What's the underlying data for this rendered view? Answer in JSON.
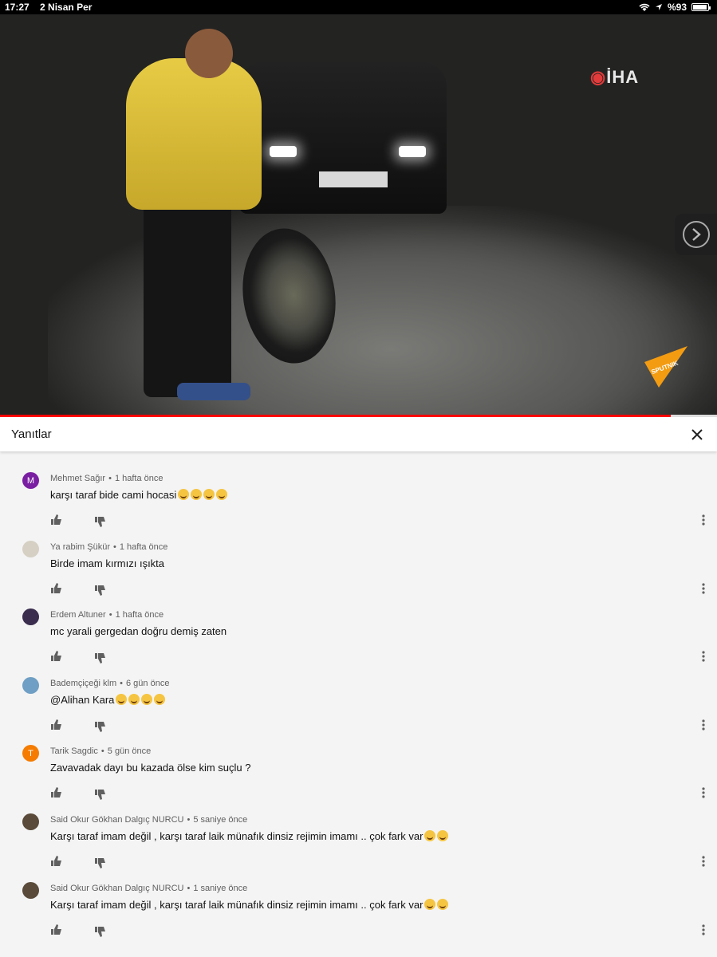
{
  "status_bar": {
    "time": "17:27",
    "date": "2 Nisan Per",
    "battery": "%93",
    "icons": [
      "wifi-icon",
      "location-icon",
      "battery-icon"
    ]
  },
  "video": {
    "watermark": "İHA",
    "brand_badge": "SPUTNIK",
    "progress_fraction": 0.935,
    "next_button": "chevron-right-icon"
  },
  "panel": {
    "title": "Yanıtlar",
    "close_icon": "close-icon"
  },
  "comments": [
    {
      "author": "Mehmet Sağır",
      "time": "1 hafta önce",
      "text": "karşı taraf bide cami hocasi",
      "emoji_count": 4,
      "avatar_letter": "M",
      "avatar_color": "#7b1fa2"
    },
    {
      "author": "Ya rabim Şükür",
      "time": "1 hafta önce",
      "text": "Birde imam kırmızı ışıkta",
      "emoji_count": 0,
      "avatar_letter": "",
      "avatar_color": "#d6d0c4"
    },
    {
      "author": "Erdem Altuner",
      "time": "1 hafta önce",
      "text": "mc yarali gergedan doğru demiş zaten",
      "emoji_count": 0,
      "avatar_letter": "",
      "avatar_color": "#3a2d4e"
    },
    {
      "author": "Bademçiçeği klm",
      "time": "6 gün önce",
      "text": "@Alihan Kara",
      "emoji_count": 4,
      "avatar_letter": "",
      "avatar_color": "#6f9fc4"
    },
    {
      "author": "Tarik Sagdic",
      "time": "5 gün önce",
      "text": "Zavavadak dayı bu kazada ölse kim suçlu ?",
      "emoji_count": 0,
      "avatar_letter": "T",
      "avatar_color": "#f57c00"
    },
    {
      "author": "Said Okur Gökhan Dalgıç NURCU",
      "time": "5 saniye önce",
      "text": "Karşı taraf imam değil  , karşı taraf laik münafık dinsiz rejimin imamı .. çok fark var",
      "emoji_count": 2,
      "avatar_letter": "",
      "avatar_color": "#5a4a3a"
    },
    {
      "author": "Said Okur Gökhan Dalgıç NURCU",
      "time": "1 saniye önce",
      "text": "Karşı taraf imam değil  , karşı taraf laik münafık dinsiz rejimin imamı .. çok fark var",
      "emoji_count": 2,
      "avatar_letter": "",
      "avatar_color": "#5a4a3a"
    }
  ]
}
